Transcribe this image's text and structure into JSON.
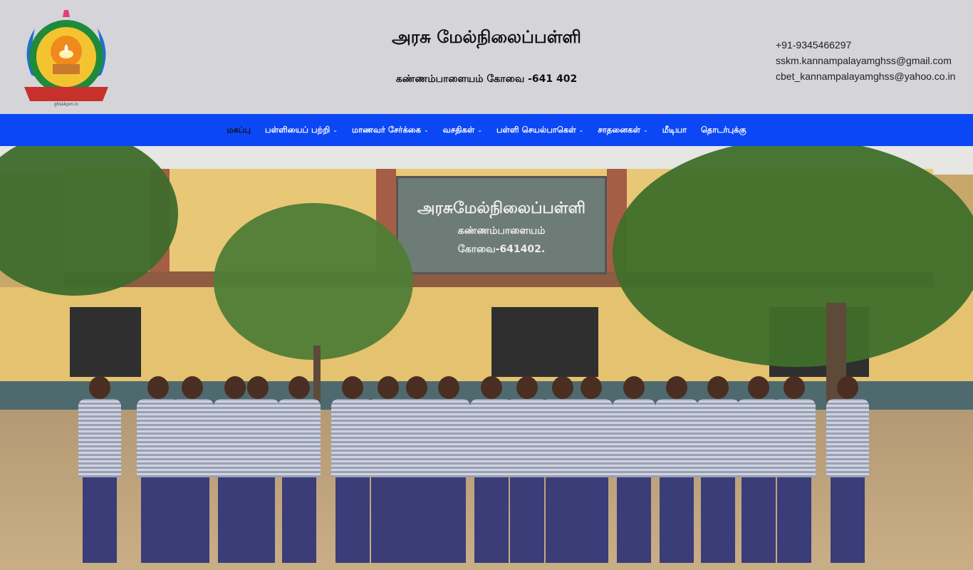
{
  "header": {
    "title": "அரசு மேல்நிலைப்பள்ளி",
    "subtitle": "கண்ணம்பாளையம் கோவை -641 402",
    "logo_alt": "school-logo",
    "contact": {
      "phone": "+91-9345466297",
      "email1": "sskm.kannampalayamghss@gmail.com",
      "email2": "cbet_kannampalayamghss@yahoo.co.in"
    }
  },
  "nav": {
    "items": [
      {
        "label": "மகப்பு",
        "dropdown": false,
        "active": true
      },
      {
        "label": "பள்ளியைப் பற்றி",
        "dropdown": true
      },
      {
        "label": "மாணவர் சேர்க்கை",
        "dropdown": true
      },
      {
        "label": "வசதிகள்",
        "dropdown": true
      },
      {
        "label": "பள்ளி செயல்பாகெள்",
        "dropdown": true
      },
      {
        "label": "சாதனைகள்",
        "dropdown": true
      },
      {
        "label": "மீடியா",
        "dropdown": false
      },
      {
        "label": "தொடர்புக்கு",
        "dropdown": false
      }
    ]
  },
  "hero": {
    "board_line1": "அரசுமேல்நிலைப்பள்ளி",
    "board_line2": "கண்ணம்பாளையம்",
    "board_line3": "கோவை-641402."
  },
  "colors": {
    "nav_bg": "#0c47f5",
    "header_bg": "#d4d4d9"
  }
}
